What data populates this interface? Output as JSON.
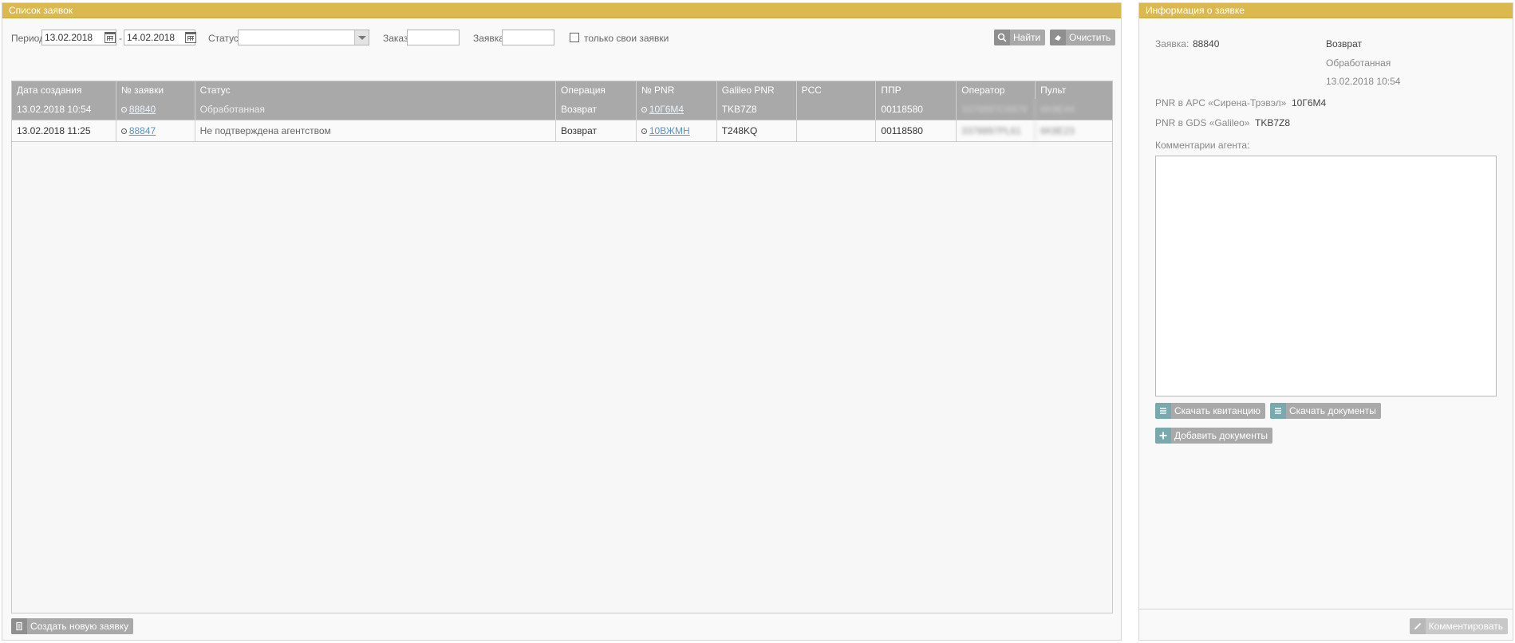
{
  "left_panel": {
    "title": "Список заявок",
    "filters": {
      "period_label": "Период",
      "date_from": "13.02.2018",
      "date_separator": "-",
      "date_to": "14.02.2018",
      "status_label": "Статус",
      "status_value": "",
      "order_label": "Заказ",
      "order_value": "",
      "request_label": "Заявка",
      "request_value": "",
      "only_mine_label": "только свои заявки"
    },
    "buttons": {
      "find": "Найти",
      "clear": "Очистить",
      "create_new": "Создать новую заявку"
    },
    "table": {
      "columns": [
        "Дата создания",
        "№ заявки",
        "Статус",
        "Операция",
        "№ PNR",
        "Galileo PNR",
        "PCC",
        "ППР",
        "Оператор",
        "Пульт"
      ],
      "rows": [
        {
          "date": "13.02.2018 10:54",
          "number": "88840",
          "status": "Обработанная",
          "operation": "Возврат",
          "pnr": "10Г6М4",
          "galileo_pnr": "TKB7Z8",
          "pcc": "",
          "ppr": "00118580",
          "operator": "3378897C6879",
          "console": "6K8E44"
        },
        {
          "date": "13.02.2018 11:25",
          "number": "88847",
          "status": "Не подтверждена агентством",
          "operation": "Возврат",
          "pnr": "10ВЖМН",
          "galileo_pnr": "T248KQ",
          "pcc": "",
          "ppr": "00118580",
          "operator": "3378897PL61",
          "console": "6K8E23"
        }
      ]
    }
  },
  "right_panel": {
    "title": "Информация о заявке",
    "request_label": "Заявка:",
    "request_number": "88840",
    "operation": "Возврат",
    "status": "Обработанная",
    "datetime": "13.02.2018 10:54",
    "pnr_ars_label": "PNR в АРС «Сирена-Трэвэл»",
    "pnr_ars_value": "10Г6М4",
    "pnr_gds_label": "PNR в GDS «Galileo»",
    "pnr_gds_value": "TKB7Z8",
    "comments_label": "Комментарии агента:",
    "comments_value": "",
    "buttons": {
      "download_receipt": "Скачать квитанцию",
      "download_docs": "Скачать документы",
      "add_docs": "Добавить документы",
      "comment": "Комментировать"
    }
  },
  "colors": {
    "header_gold": "#dcb94f",
    "button_gray": "#a9a9a9",
    "icon_teal": "#7aa9ad",
    "link_blue": "#5a93c6"
  },
  "icons": {
    "find": "search-icon",
    "clear": "eraser-icon",
    "create": "document-icon",
    "download": "list-icon",
    "add": "plus-icon",
    "comment": "pencil-icon",
    "calendar": "calendar-icon"
  }
}
